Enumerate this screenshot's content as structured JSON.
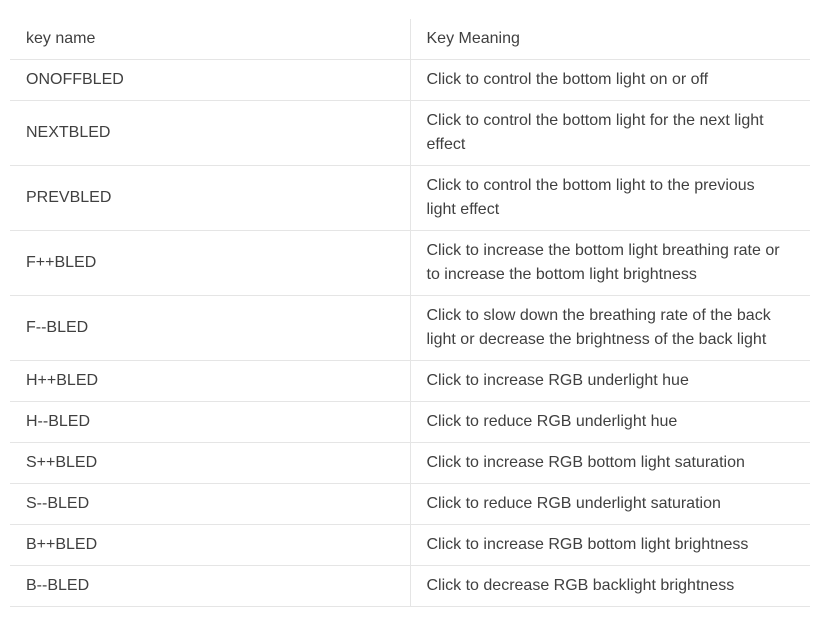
{
  "table": {
    "headers": [
      "key name",
      "Key Meaning"
    ],
    "rows": [
      [
        "ONOFFBLED",
        "Click to control the bottom light on or off"
      ],
      [
        "NEXTBLED",
        "Click to control the bottom light for the next light effect"
      ],
      [
        "PREVBLED",
        "Click to control the bottom light to the previous light effect"
      ],
      [
        "F++BLED",
        "Click to increase the bottom light breathing rate or to increase the bottom light brightness"
      ],
      [
        "F--BLED",
        "Click to slow down the breathing rate of the back light or decrease the brightness of the back light"
      ],
      [
        "H++BLED",
        "Click to increase RGB underlight hue"
      ],
      [
        "H--BLED",
        "Click to reduce RGB underlight hue"
      ],
      [
        "S++BLED",
        "Click to increase RGB bottom light saturation"
      ],
      [
        "S--BLED",
        "Click to reduce RGB underlight saturation"
      ],
      [
        "B++BLED",
        "Click to increase RGB bottom light brightness"
      ],
      [
        "B--BLED",
        "Click to decrease RGB backlight brightness"
      ]
    ]
  }
}
